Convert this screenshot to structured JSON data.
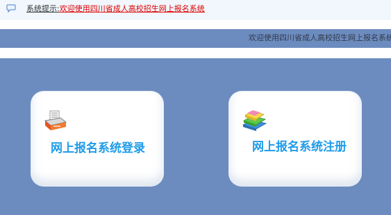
{
  "notice": {
    "label": "系统提示:",
    "text": "欢迎使用四川省成人高校招生网上报名系统"
  },
  "marquee": {
    "text": "欢迎使用四川省成人高校招生网上报名系统"
  },
  "cards": {
    "login": {
      "title": "网上报名系统登录",
      "icon": "printer-icon"
    },
    "register": {
      "title": "网上报名系统注册",
      "icon": "books-icon"
    }
  },
  "colors": {
    "background": "#6c8cbf",
    "card_title": "#1f9be8",
    "notice_highlight": "#dd0000"
  }
}
